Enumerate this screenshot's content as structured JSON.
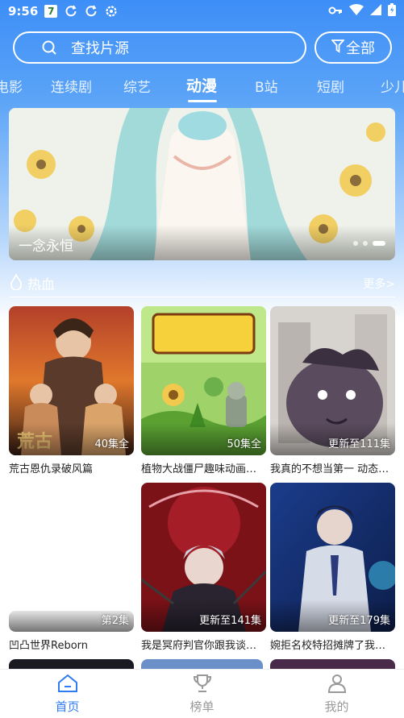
{
  "status": {
    "time": "9:56",
    "badge": "7"
  },
  "search": {
    "placeholder": "查找片源",
    "filter_label": "全部"
  },
  "tabs": [
    {
      "label": "电影"
    },
    {
      "label": "连续剧"
    },
    {
      "label": "综艺"
    },
    {
      "label": "动漫"
    },
    {
      "label": "B站"
    },
    {
      "label": "短剧"
    },
    {
      "label": "少儿"
    }
  ],
  "banner": {
    "caption": "一念永恒"
  },
  "section": {
    "title": "热血",
    "more": "更多>"
  },
  "cards": [
    {
      "name": "荒古恩仇录破风篇",
      "tag": "40集全"
    },
    {
      "name": "植物大战僵尸趣味动画第二季",
      "tag": "50集全"
    },
    {
      "name": "我真的不想当第一 动态漫画",
      "tag": "更新至111集"
    },
    {
      "name": "凹凸世界Reborn",
      "tag": "第2集"
    },
    {
      "name": "我是冥府判官你跟我谈人情",
      "tag": "更新至141集"
    },
    {
      "name": "婉拒名校特招摊牌了我是大明星",
      "tag": "更新至179集"
    }
  ],
  "bottom_nav": {
    "home": "首页",
    "rank": "榜单",
    "mine": "我的"
  },
  "colors": {
    "accent": "#2f7cf3",
    "top": "#3d8ef7"
  }
}
